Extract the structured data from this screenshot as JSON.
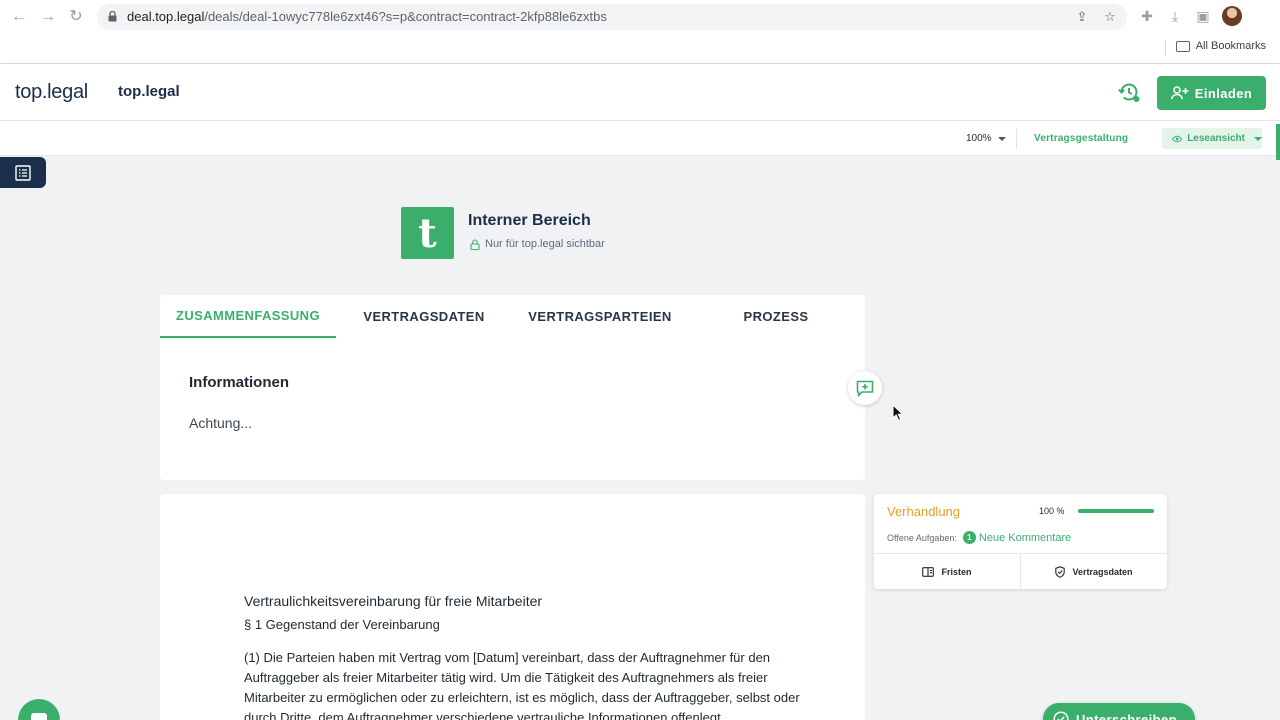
{
  "browser": {
    "url_host": "deal.top.legal",
    "url_path": "/deals/deal-1owyc778le6zxt46?s=p&contract=contract-2kfp88le6zxtbs",
    "bookmarks_label": "All Bookmarks"
  },
  "header": {
    "logo_text": "top.legal",
    "app_title": "top.legal",
    "invite_label": "Einladen"
  },
  "toolbar": {
    "zoom": "100%",
    "mode_label": "Vertragsgestaltung",
    "view_label": "Leseansicht"
  },
  "org": {
    "logo_letter": "t",
    "name": "Interner Bereich",
    "visibility": "Nur für top.legal sichtbar"
  },
  "summary": {
    "tabs": [
      "ZUSAMMENFASSUNG",
      "VERTRAGSDATEN",
      "VERTRAGSPARTEIEN",
      "PROZESS"
    ],
    "heading": "Informationen",
    "text": "Achtung..."
  },
  "document": {
    "title": "Vertraulichkeitsvereinbarung für freie Mitarbeiter",
    "section": "§ 1 Gegenstand der Vereinbarung",
    "paragraph": "(1) Die Parteien haben mit Vertrag vom [Datum] vereinbart, dass der Auftragnehmer für den Auftraggeber als freier Mitarbeiter tätig wird. Um die Tätigkeit des Auftragnehmers als freier Mitarbeiter zu ermöglichen oder zu erleichtern, ist es möglich, dass der Auftraggeber, selbst oder durch Dritte, dem Auftragnehmer verschiedene vertrauliche Informationen offenlegt."
  },
  "status": {
    "stage": "Verhandlung",
    "progress_text": "100 %",
    "progress_fraction": 1.0,
    "tasks_label": "Offene Aufgaben:",
    "tasks_count": "1",
    "tasks_link": "Neue Kommentare",
    "btn_deadlines": "Fristen",
    "btn_contract_data": "Vertragsdaten"
  },
  "actions": {
    "sign_label": "Unterschreiben"
  },
  "colors": {
    "accent": "#3aaf6c",
    "navy": "#1b2f4a",
    "stage": "#e3a021"
  }
}
